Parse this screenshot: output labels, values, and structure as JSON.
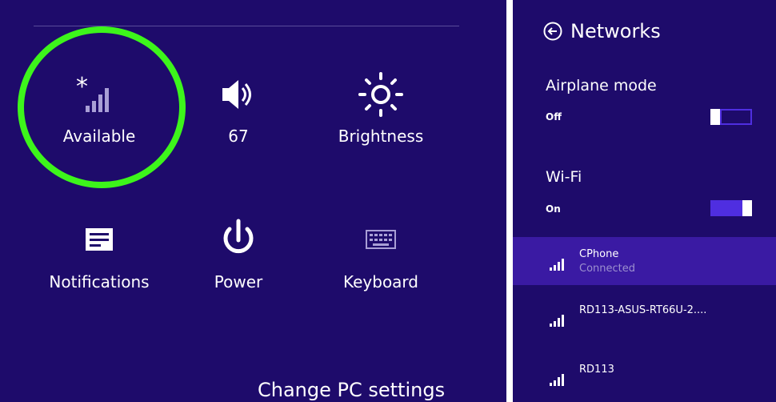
{
  "settings_panel": {
    "tiles": [
      {
        "label": "Available",
        "icon": "wifi-available-icon"
      },
      {
        "label": "67",
        "icon": "speaker-volume-icon"
      },
      {
        "label": "Brightness",
        "icon": "brightness-sun-icon"
      },
      {
        "label": "Notifications",
        "icon": "notifications-icon"
      },
      {
        "label": "Power",
        "icon": "power-icon"
      },
      {
        "label": "Keyboard",
        "icon": "keyboard-icon"
      }
    ],
    "change_pc_settings": "Change PC settings",
    "highlight_color": "#3df51b"
  },
  "networks_panel": {
    "title": "Networks",
    "airplane_mode": {
      "label": "Airplane mode",
      "state": "Off"
    },
    "wifi": {
      "label": "Wi-Fi",
      "state": "On"
    },
    "networks": [
      {
        "name": "CPhone",
        "status": "Connected"
      },
      {
        "name": "RD113-ASUS-RT66U-2...."
      },
      {
        "name": "RD113"
      }
    ]
  },
  "colors": {
    "background": "#1e0b6b",
    "selected_row": "#3a1aa3",
    "toggle_on": "#4f2ee0",
    "accent_ring": "#3df51b"
  }
}
